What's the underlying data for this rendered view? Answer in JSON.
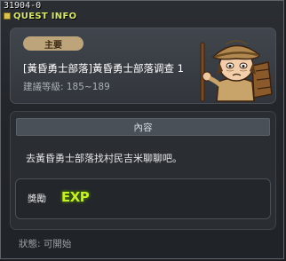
{
  "window": {
    "quest_id": "31904-0",
    "title": "QUEST INFO"
  },
  "quest": {
    "tag": "主要",
    "name": "[黃昏勇士部落]黃昏勇士部落调查 1",
    "level_range": "建議等級: 185~189"
  },
  "content": {
    "header": "內容",
    "text": "去黃昏勇士部落找村民吉米聊聊吧。",
    "reward_label": "獎勵",
    "reward_exp": "EXP"
  },
  "status": {
    "text": "狀態: 可開始"
  },
  "colors": {
    "title": "#d8e860",
    "tag_bg": "#bda47a",
    "exp": "#c8f020"
  },
  "icons": {
    "title_icon": "quest-book-icon",
    "npc": "npc-villager-portrait"
  }
}
